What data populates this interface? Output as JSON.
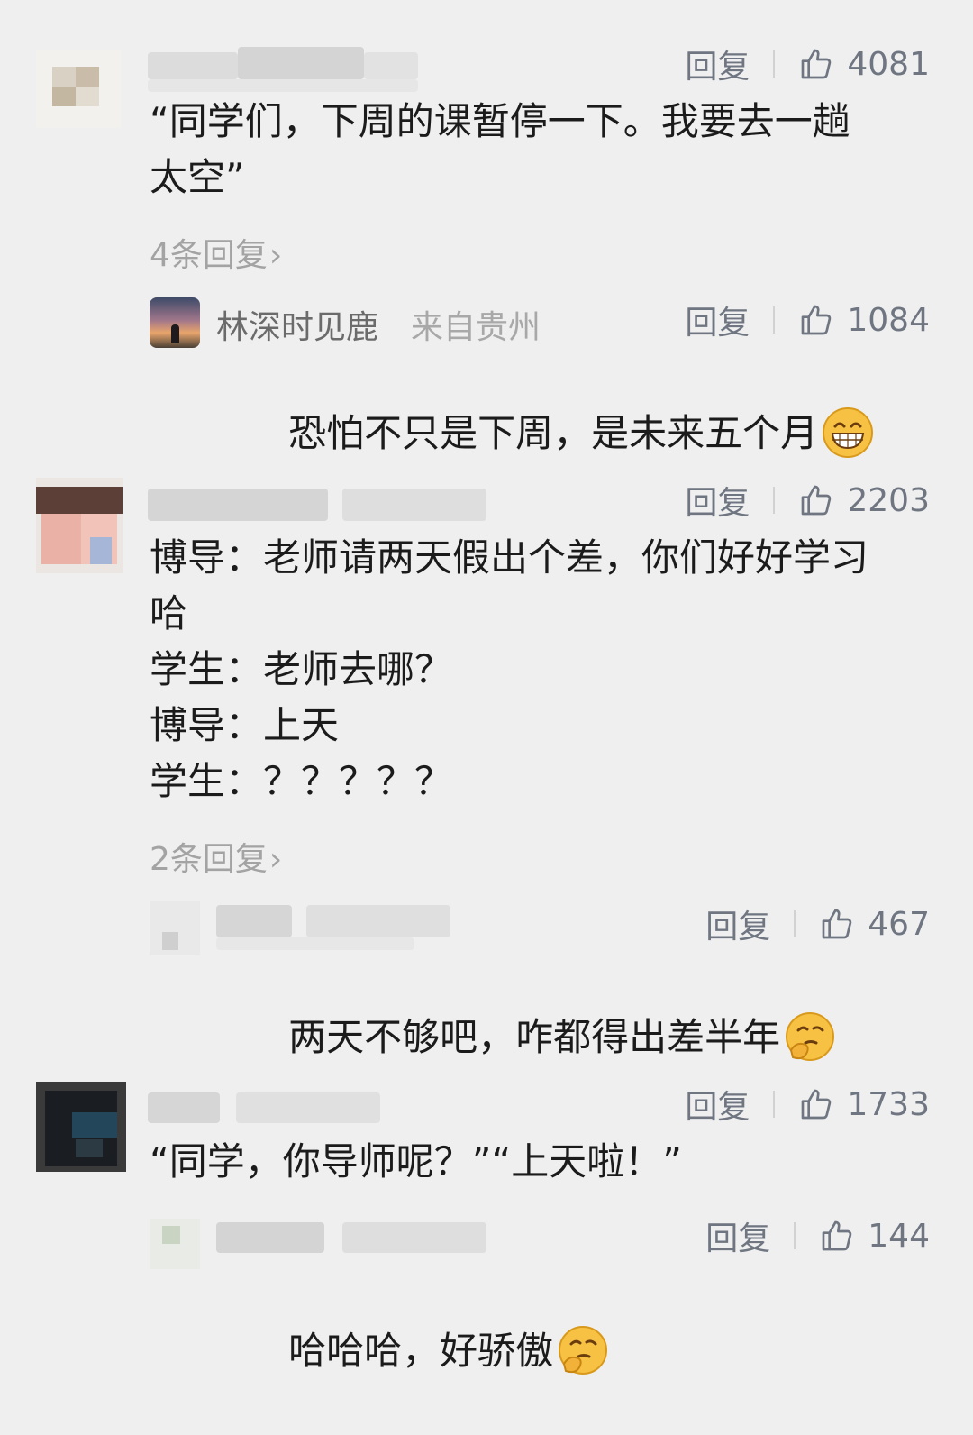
{
  "comments": [
    {
      "reply_label": "回复",
      "likes": "4081",
      "text": "“同学们，下周的课暂停一下。我要去一趟\n太空”",
      "more_replies": "4条回复",
      "reply": {
        "nickname": "林深时见鹿",
        "location": "来自贵州",
        "reply_label": "回复",
        "likes": "1084",
        "text": "恐怕不只是下周，是未来五个月",
        "emoji": "grin-emoji"
      }
    },
    {
      "reply_label": "回复",
      "likes": "2203",
      "text": "博导：老师请两天假出个差，你们好好学习\n哈\n学生：老师去哪？\n博导：上天\n学生：？？？？？",
      "more_replies": "2条回复",
      "reply": {
        "reply_label": "回复",
        "likes": "467",
        "text": "两天不够吧，咋都得出差半年",
        "emoji": "thinking-emoji"
      }
    },
    {
      "reply_label": "回复",
      "likes": "1733",
      "text": "“同学，你导师呢？”“上天啦！”",
      "reply": {
        "reply_label": "回复",
        "likes": "144",
        "text": "哈哈哈，好骄傲",
        "emoji": "thinking-emoji"
      }
    }
  ],
  "colors": {
    "background": "#efefef",
    "action_gray": "#6f7681",
    "text": "#1b1b1b",
    "muted": "#a3a3a3"
  }
}
